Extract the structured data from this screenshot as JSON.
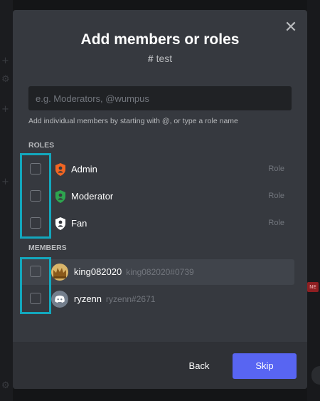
{
  "dialog": {
    "title": "Add members or roles",
    "channel_hash": "#",
    "channel_name": "test",
    "close_glyph": "✕"
  },
  "search": {
    "placeholder": "e.g. Moderators, @wumpus",
    "value": "",
    "hint": "Add individual members by starting with @, or type a role name"
  },
  "roles": {
    "label": "ROLES",
    "items": [
      {
        "name": "Admin",
        "tag": "Role",
        "color": "#f26522",
        "checked": false
      },
      {
        "name": "Moderator",
        "tag": "Role",
        "color": "#2ea44f",
        "checked": false
      },
      {
        "name": "Fan",
        "tag": "Role",
        "color": "#ffffff",
        "checked": false
      }
    ]
  },
  "members": {
    "label": "MEMBERS",
    "items": [
      {
        "name": "king082020",
        "discriminator": "king082020#0739",
        "checked": false
      },
      {
        "name": "ryzenn",
        "discriminator": "ryzenn#2671",
        "checked": false
      }
    ]
  },
  "footer": {
    "back_label": "Back",
    "skip_label": "Skip"
  },
  "background": {
    "badge": "NE"
  },
  "colors": {
    "accent": "#5865f2",
    "highlight": "#13a7bd",
    "modal_bg": "#36393f"
  }
}
